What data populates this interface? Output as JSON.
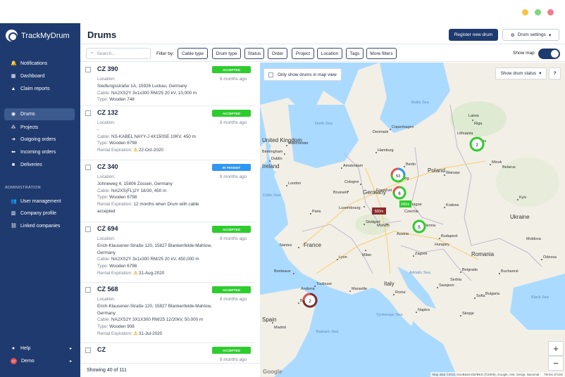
{
  "app": {
    "name": "TrackMyDrum"
  },
  "sidebar": {
    "items": [
      {
        "label": "Notifications",
        "icon": "bell-icon"
      },
      {
        "label": "Dashboard",
        "icon": "dashboard-icon"
      },
      {
        "label": "Claim reports",
        "icon": "warning-icon"
      },
      {
        "label": "Drums",
        "icon": "location-icon"
      },
      {
        "label": "Projects",
        "icon": "projects-icon"
      },
      {
        "label": "Outgoing orders",
        "icon": "arrow-right-icon"
      },
      {
        "label": "Incoming orders",
        "icon": "arrow-left-icon"
      },
      {
        "label": "Deliveries",
        "icon": "truck-icon"
      }
    ],
    "admin_header": "ADMINISTRATION",
    "admin_items": [
      {
        "label": "User management",
        "icon": "users-icon"
      },
      {
        "label": "Company profile",
        "icon": "building-icon"
      },
      {
        "label": "Linked companies",
        "icon": "link-icon"
      }
    ],
    "help": "Help",
    "user": "Demo",
    "user_initials": "DT"
  },
  "header": {
    "title": "Drums",
    "register_button": "Register new drum",
    "settings_button": "Drum settings"
  },
  "filters": {
    "search_placeholder": "Search...",
    "filter_by": "Filter by:",
    "chips": [
      "Cable type",
      "Drum type",
      "Status",
      "Order",
      "Project",
      "Location",
      "Tags",
      "More filters"
    ],
    "show_map": "Show map"
  },
  "drums": [
    {
      "code": "CZ 390",
      "status": "ACCEPTED",
      "ago": "8 months ago",
      "location": "Siedlungsstraße 1A, 15926 Luckau, Germany",
      "cable": "NA2XS2Y 3x1x300 RM/25 20 kV, 10,000 m",
      "type": "Wooden 748"
    },
    {
      "code": "CZ 132",
      "status": "ACCEPTED",
      "ago": "8 months ago",
      "location": "-",
      "cable": "NS-KABEL NAYY-J 4X150SE 10KV, 450 m",
      "type": "Wooden 6798",
      "rental": "22-Oct-2020"
    },
    {
      "code": "CZ 340",
      "status": "IN TRANSIT",
      "ago": "8 months ago",
      "location": "Johneweg 4, 15806 Zossen, Germany",
      "cable": "NA2XS(FL)2Y 18/30, 450 m",
      "type": "Wooden 6798",
      "rental": "12 months when Drum with cable accepted"
    },
    {
      "code": "CZ 694",
      "status": "ACCEPTED",
      "ago": "8 months ago",
      "location": "Erich-Klausener-Straße 120, 15827 Blankenfelde-Mahlow, Germany",
      "cable": "NA2XS2Y 3x1x300 RM/25 20 kV, 450,000 m",
      "type": "Wooden 6798",
      "rental": "31-Aug-2020"
    },
    {
      "code": "CZ 568",
      "status": "ACCEPTED",
      "ago": "8 months ago",
      "location": "Erich-Klausener-Straße 120, 15827 Blankenfelde-Mahlow, Germany",
      "cable": "NA2XS2Y 3X1X300 RM/25 12/20kV, 50,000 m",
      "type": "Wooden 908",
      "rental": "31-Jul-2020"
    },
    {
      "code": "CZ",
      "status": "ACCEPTED",
      "ago": "8 months ago"
    }
  ],
  "field_labels": {
    "location": "Location:",
    "cable": "Cable:",
    "type": "Type:",
    "rental": "Rental Expiration:"
  },
  "footer": {
    "showing": "Showing 40 of 111"
  },
  "map": {
    "only_in_view": "Only show drums in map view",
    "status_dropdown": "Show drum status",
    "help": "?",
    "attribution": "Map data ©2021 GeoBasis-DE/BKG (©2009), Google, Inst. Geogr. Nacional",
    "terms": "Terms of Use",
    "google": "Google",
    "clusters": [
      "2",
      "53",
      "6",
      "5",
      "2"
    ],
    "tags": [
      "500m",
      "240m"
    ],
    "countries": [
      "United Kingdom",
      "Ireland",
      "Germany",
      "Poland",
      "Belarus",
      "Ukraine",
      "France",
      "Italy",
      "Spain",
      "Romania",
      "Czechia",
      "Austria",
      "Latvia",
      "Lithuania",
      "Denmark",
      "Moldova",
      "Hungary",
      "Serbia",
      "Bulgaria",
      "Andorra"
    ],
    "seas": [
      "North Sea",
      "Baltic Sea",
      "Celtic Sea",
      "Balearic Sea",
      "Tyrrhenian Sea",
      "Adriatic Sea",
      "Black Sea"
    ],
    "cities": [
      "Dublin",
      "London",
      "Amsterdam",
      "Berlin",
      "Hamburg",
      "Paris",
      "Munich",
      "Prague",
      "Vienna",
      "Warsaw",
      "Kyiv",
      "Minsk",
      "Riga",
      "Vilnius",
      "Budapest",
      "Milan",
      "Rome",
      "Barcelona",
      "Madrid",
      "Belgrade",
      "Bucharest",
      "Sofia",
      "Copenhagen",
      "Zagreb",
      "Lyon",
      "Marseille",
      "Brussels",
      "Luxembourg",
      "Frankfurt",
      "Birmingham",
      "Manchester",
      "Bordeaux",
      "Toulouse",
      "Nantes",
      "Naples",
      "Sarajevo",
      "Skopje",
      "Odessa",
      "Krakow",
      "Cologne",
      "Leipzig",
      "Stuttgart"
    ]
  },
  "colors": {
    "sidebar": "#1f3a6e",
    "accepted": "#2ecc2e",
    "in_transit": "#2f97f2",
    "primary": "#1f3a6e"
  }
}
